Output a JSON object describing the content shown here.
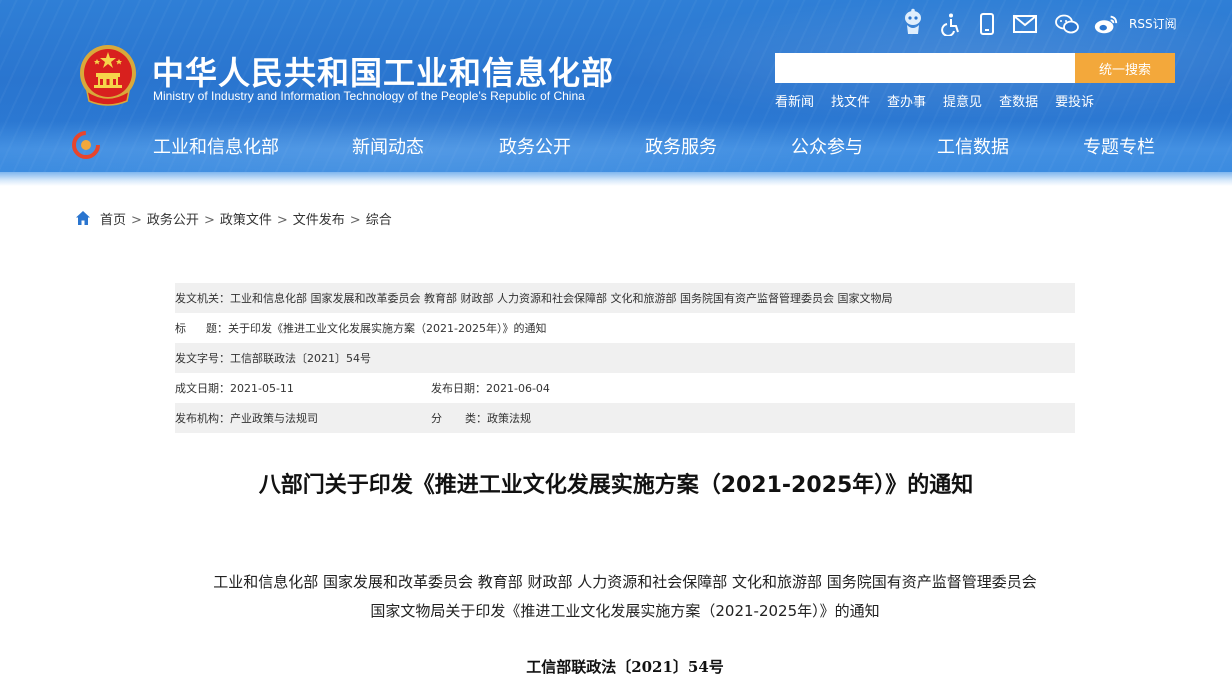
{
  "header": {
    "title_cn": "中华人民共和国工业和信息化部",
    "title_en": "Ministry of Industry and Information Technology of the People’s Republic of China",
    "top_icons": [
      "robot-assistant-icon",
      "accessibility-icon",
      "mobile-icon",
      "mail-icon",
      "wechat-icon",
      "weibo-icon"
    ],
    "rss_label": "RSS订阅",
    "search": {
      "placeholder": "",
      "button_label": "统一搜索"
    },
    "quick_links": [
      "看新闻",
      "找文件",
      "查办事",
      "提意见",
      "查数据",
      "要投诉"
    ],
    "nav": [
      "工业和信息化部",
      "新闻动态",
      "政务公开",
      "政务服务",
      "公众参与",
      "工信数据",
      "专题专栏"
    ]
  },
  "breadcrumb": [
    "首页",
    "政务公开",
    "政策文件",
    "文件发布",
    "综合"
  ],
  "meta": {
    "issuer_label": "发文机关：",
    "issuer_value": "工业和信息化部 国家发展和改革委员会 教育部 财政部 人力资源和社会保障部 文化和旅游部 国务院国有资产监督管理委员会 国家文物局",
    "title_label_a": "标",
    "title_label_b": "题：",
    "title_value": "关于印发《推进工业文化发展实施方案（2021-2025年）》的通知",
    "docno_label": "发文字号：",
    "docno_value": "工信部联政法〔2021〕54号",
    "written_label": "成文日期：",
    "written_value": "2021-05-11",
    "published_label": "发布日期：",
    "published_value": "2021-06-04",
    "org_label": "发布机构：",
    "org_value": "产业政策与法规司",
    "category_label_a": "分",
    "category_label_b": "类：",
    "category_value": "政策法规"
  },
  "article": {
    "title": "八部门关于印发《推进工业文化发展实施方案（2021-2025年）》的通知",
    "intro_line1": "工业和信息化部 国家发展和改革委员会 教育部 财政部 人力资源和社会保障部 文化和旅游部 国务院国有资产监督管理委员会",
    "intro_line2": "国家文物局关于印发《推进工业文化发展实施方案（2021-2025年）》的通知",
    "doc_no": "工信部联政法〔2021〕54号"
  },
  "colors": {
    "header_blue": "#2b78d2",
    "search_button": "#f3a83b",
    "meta_shade": "#f0f0f0"
  }
}
